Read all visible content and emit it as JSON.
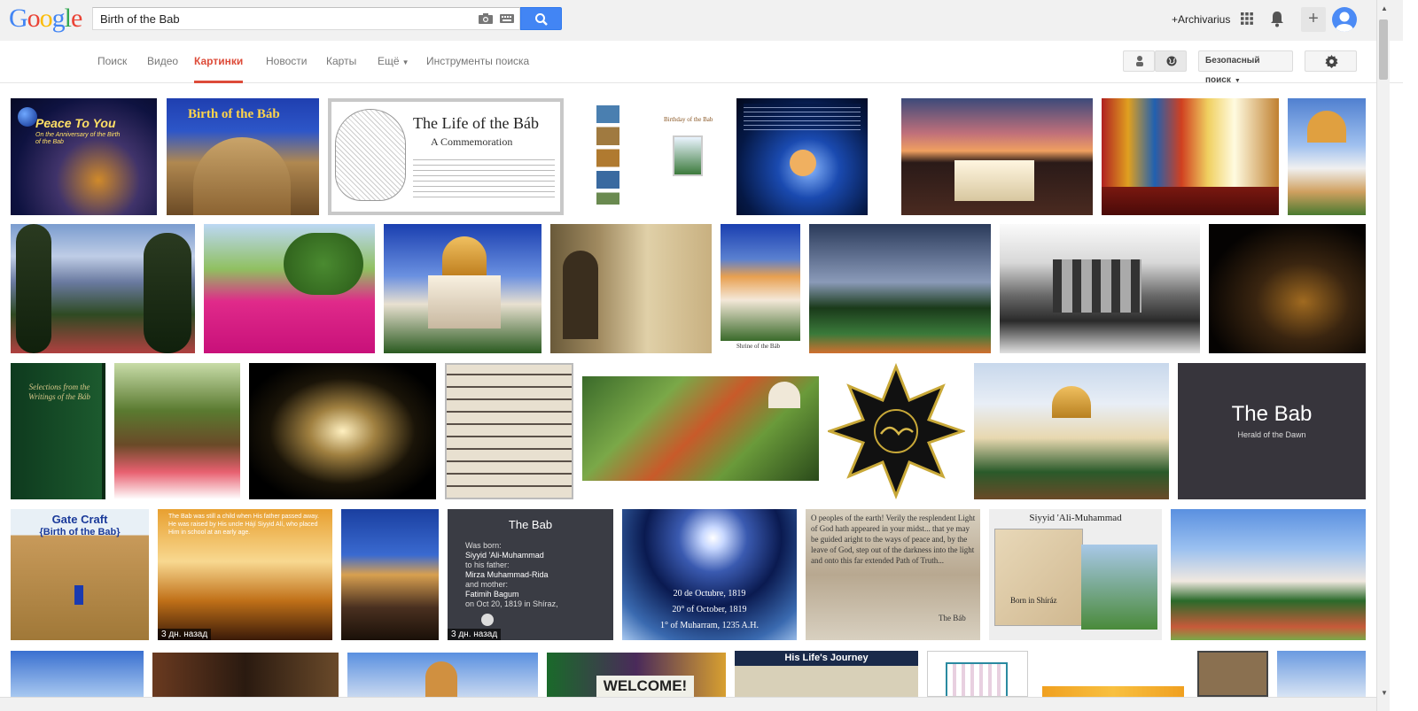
{
  "header": {
    "logo": "Google",
    "search_value": "Birth of the Bab",
    "account": "+Archivarius"
  },
  "nav": {
    "tabs": [
      {
        "label": "Поиск"
      },
      {
        "label": "Видео"
      },
      {
        "label": "Картинки",
        "active": true
      },
      {
        "label": "Новости"
      },
      {
        "label": "Карты"
      },
      {
        "label": "Ещё"
      },
      {
        "label": "Инструменты поиска"
      }
    ],
    "safesearch": "Безопасный поиск"
  },
  "colors": {
    "accent": "#dd4b39",
    "search_blue": "#4285f4"
  },
  "icons": [
    "camera-icon",
    "keyboard-icon",
    "search-icon",
    "apps-icon",
    "bell-icon",
    "plus-icon",
    "avatar",
    "person-icon",
    "globe-icon",
    "gear-icon"
  ],
  "results": {
    "tile_texts": {
      "peace_title": "Peace To You",
      "peace_sub": "On the Anniversary of the Birth of the Bab",
      "birth_title": "Birth of the Báb",
      "life_title": "The Life of the Báb",
      "life_sub": "A Commemoration",
      "birthday_title": "Birthday of the Bab",
      "shrine_cap": "Shrine of the Báb",
      "book_title": "Selections from the Writings of the Báb",
      "thebab_title": "The Bab",
      "thebab_sub": "Herald of the Dawn",
      "gate_title": "Gate Craft",
      "gate_sub": "{Birth of the Bab}",
      "child_text": "The Bab was still a child when His father passed away. He was raised by His uncle Hájí Siyyid Alí, who placed Him in school at an early age.",
      "badge_days": "3 дн. назад",
      "slide_title": "The Bab",
      "slide_lines": [
        "Was born:",
        "Siyyid 'Ali-Muhammad",
        "to his father:",
        "Mirza Muhammad-Rida",
        "and mother:",
        "Fatimih Bagum",
        "on Oct 20, 1819 in Shíraz,"
      ],
      "earth_lines": [
        "20 de Octubre, 1819",
        "20° of October, 1819",
        "1° of Muharram, 1235 A.H."
      ],
      "quote_text": "O peoples of the earth! Verily the resplendent Light of God hath appeared in your midst... that ye may be guided aright to the ways of peace and, by the leave of God, step out of the darkness into the light and onto this far extended Path of Truth...",
      "quote_sig": "The Báb",
      "siyyid_title": "Siyyid 'Ali-Muhammad",
      "siyyid_born": "Born in Shíráz",
      "journey_title": "His Life's Journey",
      "welcome_text": "WELCOME!"
    }
  }
}
